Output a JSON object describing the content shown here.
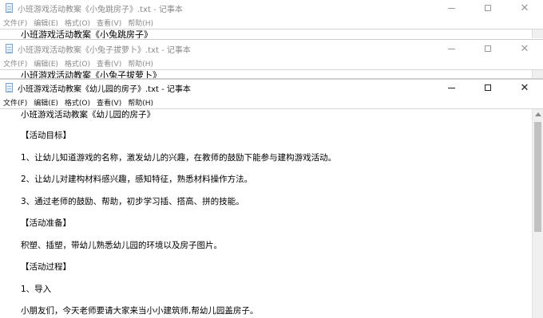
{
  "windows": [
    {
      "title": "小班游戏活动教案《小兔跳房子》.txt - 记事本",
      "first_line": "小班游戏活动教案《小兔跳房子》"
    },
    {
      "title": "小班游戏活动教案《小兔子拔萝卜》.txt - 记事本",
      "first_line": "小班游戏活动教案《小兔子拔萝卜》"
    },
    {
      "title": "小班游戏活动教案《幼儿园的房子》.txt - 记事本",
      "lines": [
        "小班游戏活动教案《幼儿园的房子》",
        "【活动目标】",
        "1、让幼儿知道游戏的名称，激发幼儿的兴趣，在教师的鼓励下能参与建构游戏活动。",
        "2、让幼儿对建构材料感兴趣，感知特征，熟悉材料操作方法。",
        "3、通过老师的鼓励、帮助，初步学习插、搭高、拼的技能。",
        "【活动准备】",
        "积塑、插塑，带幼儿熟悉幼儿园的环境以及房子图片。",
        "【活动过程】",
        "1、导入",
        "小朋友们，今天老师要请大家来当小小建筑师,帮幼儿园盖房子。"
      ]
    }
  ],
  "menu": [
    "文件(F)",
    "编辑(E)",
    "格式(O)",
    "查看(V)",
    "帮助(H)"
  ],
  "controls": {
    "minimize": "—",
    "maximize": "☐",
    "close": "✕"
  }
}
